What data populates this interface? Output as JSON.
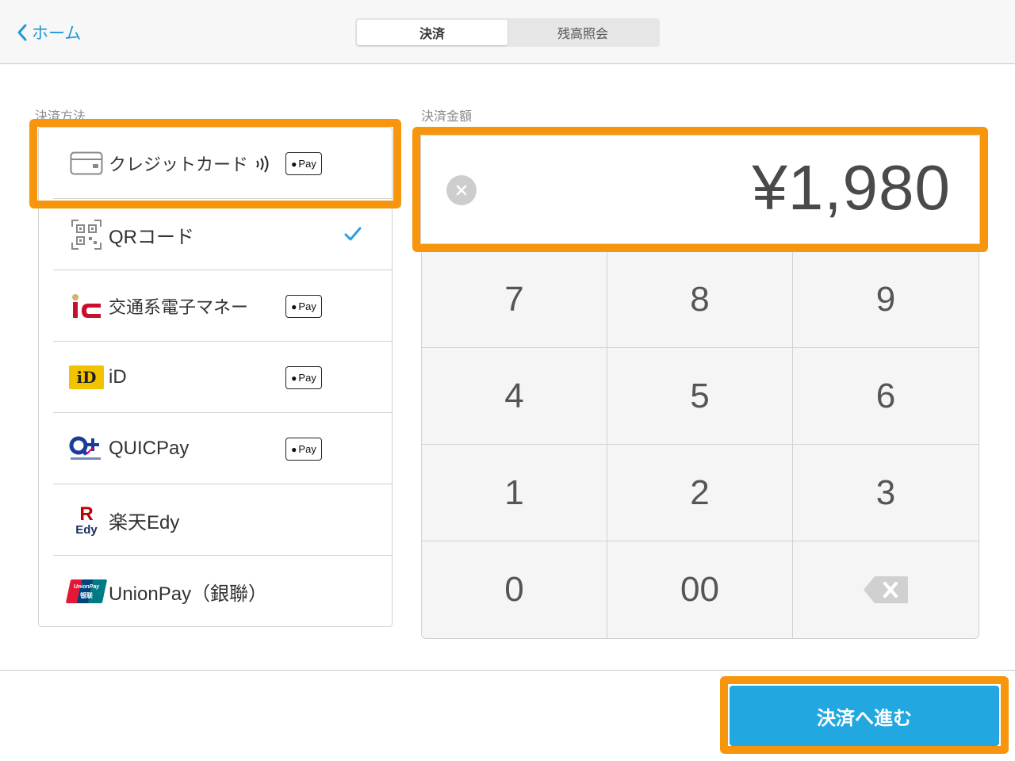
{
  "header": {
    "back_label": "ホーム",
    "tabs": [
      {
        "label": "決済",
        "active": true
      },
      {
        "label": "残高照会",
        "active": false
      }
    ]
  },
  "payment": {
    "section_label": "決済方法",
    "methods": [
      {
        "label": "クレジットカード",
        "icon": "credit-card-icon",
        "contactless": true,
        "apple_pay": true,
        "selected": false
      },
      {
        "label": "QRコード",
        "icon": "qr-code-icon",
        "contactless": false,
        "apple_pay": false,
        "selected": true
      },
      {
        "label": "交通系電子マネー",
        "icon": "transit-ic-icon",
        "contactless": false,
        "apple_pay": true,
        "selected": false
      },
      {
        "label": "iD",
        "icon": "id-logo-icon",
        "contactless": false,
        "apple_pay": true,
        "selected": false
      },
      {
        "label": "QUICPay",
        "icon": "quicpay-logo-icon",
        "contactless": false,
        "apple_pay": true,
        "selected": false
      },
      {
        "label": "楽天Edy",
        "icon": "rakuten-edy-logo-icon",
        "contactless": false,
        "apple_pay": false,
        "selected": false
      },
      {
        "label": "UnionPay（銀聯）",
        "icon": "unionpay-logo-icon",
        "contactless": false,
        "apple_pay": false,
        "selected": false
      }
    ],
    "apple_pay_label": "Pay",
    "logo_text": {
      "id": "iD",
      "edy_r": "R",
      "edy": "Edy",
      "unionpay": "UnionPay",
      "unionpay_cn": "银联"
    }
  },
  "amount": {
    "section_label": "決済金額",
    "value": "¥1,980"
  },
  "keypad": {
    "keys": [
      "7",
      "8",
      "9",
      "4",
      "5",
      "6",
      "1",
      "2",
      "3",
      "0",
      "00",
      "backspace"
    ]
  },
  "footer": {
    "proceed_label": "決済へ進む"
  },
  "colors": {
    "accent": "#1f9ad8",
    "cta": "#22a7e0",
    "highlight": "#f7960d",
    "check": "#2ba0dc"
  }
}
